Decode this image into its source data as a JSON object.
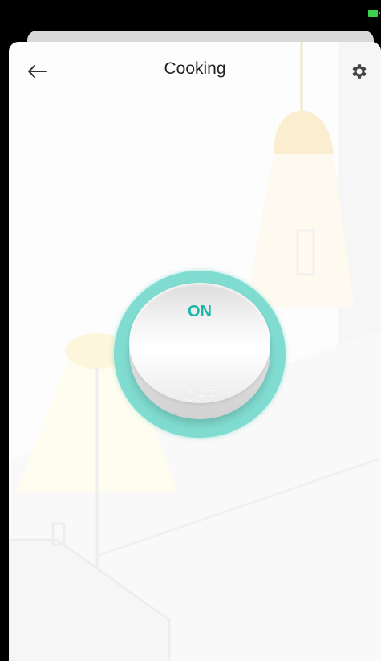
{
  "header": {
    "title": "Cooking"
  },
  "toggle": {
    "on_label": "ON",
    "off_label": "OFF",
    "state": "on"
  },
  "colors": {
    "accent": "#19b5a9",
    "ring": "#80dcd0",
    "battery": "#3ccf4e"
  },
  "icons": {
    "back": "arrow-left-icon",
    "settings": "gear-icon",
    "battery": "battery-icon"
  }
}
